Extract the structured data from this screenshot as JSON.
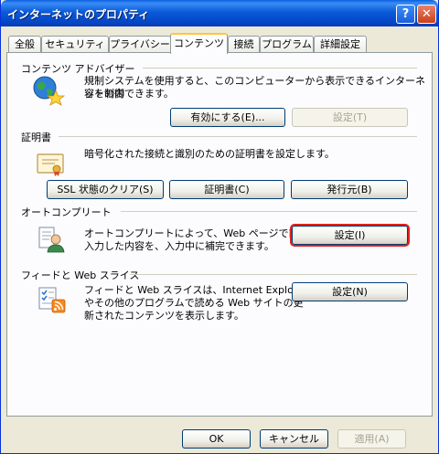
{
  "window": {
    "title": "インターネットのプロパティ",
    "help_label": "?",
    "close_label": "✕"
  },
  "tabs": [
    {
      "label": "全般"
    },
    {
      "label": "セキュリティ"
    },
    {
      "label": "プライバシー"
    },
    {
      "label": "コンテンツ"
    },
    {
      "label": "接続"
    },
    {
      "label": "プログラム"
    },
    {
      "label": "詳細設定"
    }
  ],
  "content_advisor": {
    "title": "コンテンツ アドバイザー",
    "description_line1": "規制システムを使用すると、このコンピューターから表示できるインターネットの内",
    "description_line2": "容を制御できます。",
    "enable_label": "有効にする(E)...",
    "settings_label": "設定(T)"
  },
  "certificates": {
    "title": "証明書",
    "description": "暗号化された接続と識別のための証明書を設定します。",
    "clear_ssl_label": "SSL 状態のクリア(S)",
    "certificates_label": "証明書(C)",
    "publishers_label": "発行元(B)"
  },
  "autocomplete": {
    "title": "オートコンプリート",
    "description_line1": "オートコンプリートによって、Web ページで前回",
    "description_line2": "入力した内容を、入力中に補完できます。",
    "settings_label": "設定(I)"
  },
  "feeds": {
    "title": "フィードと Web スライス",
    "description_line1": "フィードと Web スライスは、Internet Explorer",
    "description_line2": "やその他のプログラムで読める Web サイトの更",
    "description_line3": "新されたコンテンツを表示します。",
    "settings_label": "設定(N)"
  },
  "dialog_buttons": {
    "ok_label": "OK",
    "cancel_label": "キャンセル",
    "apply_label": "適用(A)"
  },
  "colors": {
    "titlebar": "#0b5bd8",
    "focus_ring": "#e0201a",
    "dialog_bg": "#ece9d8"
  }
}
